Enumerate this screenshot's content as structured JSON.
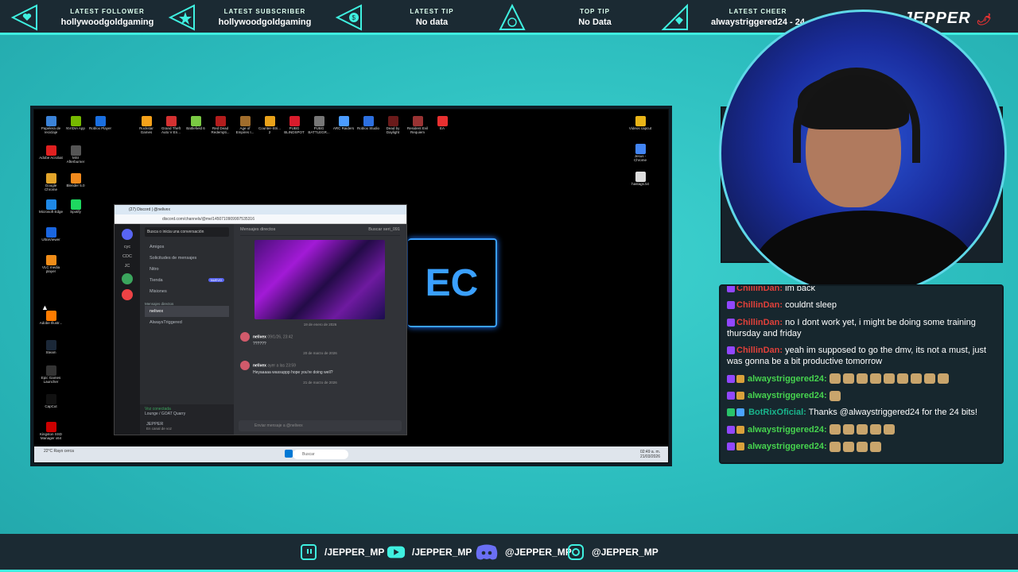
{
  "topbar": {
    "items": [
      {
        "title": "LATEST FOLLOWER",
        "value": "hollywoodgoldgaming"
      },
      {
        "title": "LATEST SUBSCRIBER",
        "value": "hollywoodgoldgaming"
      },
      {
        "title": "LATEST TIP",
        "value": "No data"
      },
      {
        "title": "TOP TIP",
        "value": "No Data"
      },
      {
        "title": "LATEST CHEER",
        "value": "alwaystriggered24 - 24"
      }
    ],
    "brand": "JEPPER"
  },
  "desktop": {
    "icons": [
      "Papelera de reciclaje",
      "NVIDIA App",
      "Roblox Player",
      "Rockstar Games",
      "Grand Theft Auto V En...",
      "Battlefield 6",
      "Red Dead Redempti...",
      "Age of Empires I...",
      "Counter-Stri... 2",
      "PUBG BLINDSPOT",
      "PUBG BATTLEGR...",
      "ARC Raiders",
      "Roblox Studio",
      "Dead by Daylight",
      "Resident Evil Requiem",
      "EA",
      "Adobe Acrobat",
      "MSI Afterburner",
      "Google Chrome",
      "Blender 5.0",
      "Microsoft Edge",
      "Spotify",
      "UltraViewer",
      "VLC media player",
      "Adobe Illustr...",
      "Steam",
      "Epic Games Launcher",
      "CapCut",
      "Kingston SSD Manager x64",
      "Videos capcut",
      "Jesus - Chrome",
      "hastags.txt"
    ],
    "taskbar": {
      "weather": "22°C Rayo cerca",
      "search": "Buscar",
      "time": "02:49 a. m.",
      "date": "21/03/2026"
    }
  },
  "discord": {
    "tab": "(27) Discord | @nelivex",
    "url": "discord.com/channels/@me/1450710909997535316",
    "header": "Mensajes directos",
    "search_placeholder": "Busca o inicia una conversación",
    "chat_search": "Buscar seri_091",
    "guilds": [
      "cyc",
      "CDC",
      "JC"
    ],
    "menu": [
      "Amigos",
      "Solicitudes de mensajes",
      "Nitro",
      "Tienda",
      "Misiones"
    ],
    "new_badge": "NUEVO",
    "dm_section": "Mensajes directos",
    "dms": [
      "nelivex",
      "AlwaysTriggered"
    ],
    "voice_status": "Voz conectada",
    "voice_channel": "Lounge / GOAT Quarry",
    "user": "JEPPER",
    "user_status": "En canal de voz",
    "dates": [
      "19 de enero de 2026",
      "20 de marzo de 2026",
      "21 de marzo de 2026"
    ],
    "messages": [
      {
        "nick": "nelivex",
        "tag": "GOAT",
        "time": "09/1/26, 23:42",
        "text": "??????"
      },
      {
        "nick": "nelivex",
        "tag": "GOAT",
        "time": "ayer a las 23:59",
        "text": "Heyaaaaa wassuppp hope you're doing well?"
      }
    ],
    "input_placeholder": "Enviar mensaje a @nelivex"
  },
  "chat": {
    "lines": [
      {
        "user": "ChillinDan:",
        "text": "im back",
        "type": "red"
      },
      {
        "user": "ChillinDan:",
        "text": "couldnt sleep",
        "type": "red"
      },
      {
        "user": "ChillinDan:",
        "text": "no I dont work yet, i might be doing some training thursday and friday",
        "type": "red"
      },
      {
        "user": "ChillinDan:",
        "text": "yeah im supposed to go the dmv, its not a must, just was gonna be a bit productive tomorrow",
        "type": "red"
      },
      {
        "user": "alwaystriggered24:",
        "text": "",
        "type": "green"
      },
      {
        "user": "alwaystriggered24:",
        "text": "",
        "type": "green"
      },
      {
        "user": "BotRixOficial:",
        "text": "Thanks @alwaystriggered24 for the 24 bits!",
        "type": "teal"
      },
      {
        "user": "alwaystriggered24:",
        "text": "",
        "type": "green"
      },
      {
        "user": "alwaystriggered24:",
        "text": "",
        "type": "green"
      }
    ]
  },
  "socials": [
    {
      "icon": "twitch-icon",
      "handle": "/JEPPER_MP"
    },
    {
      "icon": "youtube-icon",
      "handle": "/JEPPER_MP"
    },
    {
      "icon": "discord-icon",
      "handle": "@JEPPER_MP"
    },
    {
      "icon": "instagram-icon",
      "handle": "@JEPPER_MP"
    }
  ]
}
